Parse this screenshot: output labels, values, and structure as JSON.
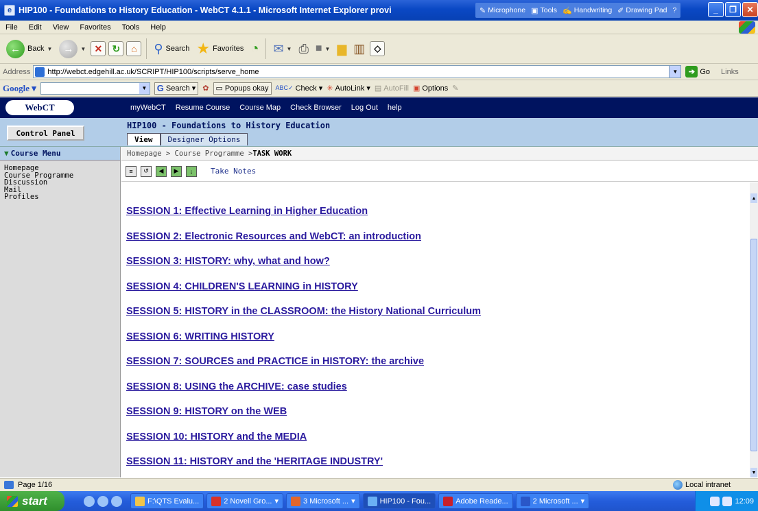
{
  "window": {
    "title": "HIP100 - Foundations to History Education - WebCT 4.1.1 - Microsoft Internet Explorer provi",
    "langbar": [
      "Microphone",
      "Tools",
      "Handwriting",
      "Drawing Pad"
    ]
  },
  "menu": [
    "File",
    "Edit",
    "View",
    "Favorites",
    "Tools",
    "Help"
  ],
  "toolbar": {
    "back": "Back",
    "search": "Search",
    "favorites": "Favorites"
  },
  "address": {
    "label": "Address",
    "url": "http://webct.edgehill.ac.uk/SCRIPT/HIP100/scripts/serve_home",
    "go": "Go",
    "links": "Links"
  },
  "google": {
    "logo": "Google",
    "search": "Search",
    "popups": "Popups okay",
    "check": "Check",
    "autolink": "AutoLink",
    "autofill": "AutoFill",
    "options": "Options"
  },
  "webct": {
    "logo": "WebCT",
    "nav": [
      "myWebCT",
      "Resume Course",
      "Course Map",
      "Check Browser",
      "Log Out",
      "help"
    ],
    "control_panel": "Control Panel",
    "course_title": "HIP100 - Foundations to History Education",
    "tabs": [
      "View",
      "Designer Options"
    ]
  },
  "sidebar": {
    "heading": "Course Menu",
    "items": [
      "Homepage",
      "Course Programme",
      "Discussion",
      "Mail",
      "Profiles"
    ]
  },
  "breadcrumb": {
    "path": "Homepage > Course Programme > ",
    "current": "TASK WORK"
  },
  "content_toolbar": {
    "take_notes": "Take Notes"
  },
  "sessions": [
    "SESSION 1: Effective Learning in Higher Education",
    "SESSION 2: Electronic Resources and WebCT: an introduction",
    "SESSION 3: HISTORY: why, what and how?",
    "SESSION 4: CHILDREN'S LEARNING in HISTORY",
    "SESSION 5: HISTORY in the CLASSROOM: the History National Curriculum",
    "SESSION 6: WRITING HISTORY",
    "SESSION 7: SOURCES and PRACTICE in HISTORY: the archive",
    "SESSION 8: USING the ARCHIVE: case studies",
    "SESSION 9: HISTORY on the WEB",
    "SESSION 10: HISTORY and the MEDIA",
    "SESSION 11: HISTORY and the 'HERITAGE INDUSTRY'"
  ],
  "status": {
    "page": "Page 1/16",
    "zone": "Local intranet"
  },
  "taskbar": {
    "start": "start",
    "tasks": [
      "F:\\QTS Evalu...",
      "2 Novell Gro...",
      "3 Microsoft ...",
      "HIP100 - Fou...",
      "Adobe Reade...",
      "2 Microsoft ..."
    ],
    "clock": "12:09"
  },
  "colors": {
    "webct_navy": "#00135f",
    "header_blue": "#b2cde8",
    "link": "#2a1a9e"
  }
}
